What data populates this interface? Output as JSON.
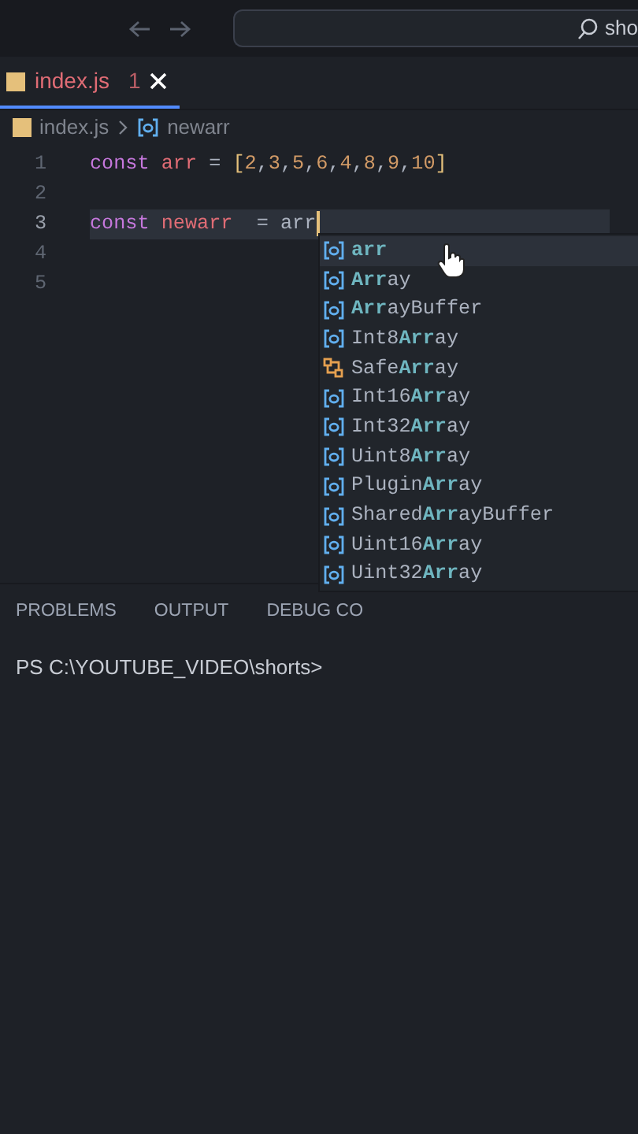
{
  "titlebar": {
    "search": {
      "value": "sho"
    }
  },
  "tabs": [
    {
      "label": "index.js",
      "problems": "1",
      "selected": true
    }
  ],
  "breadcrumb": [
    {
      "label": "index.js",
      "kind": "file"
    },
    {
      "label": "newarr",
      "kind": "variable"
    }
  ],
  "lines": [
    {
      "number": "1",
      "current": false,
      "tokens": [
        {
          "text": "const ",
          "kind": "keyword"
        },
        {
          "text": "arr",
          "kind": "variable"
        },
        {
          "text": " = ",
          "kind": "plain"
        },
        {
          "text": "[",
          "kind": "bracket"
        },
        {
          "text": "2",
          "kind": "number"
        },
        {
          "text": ",",
          "kind": "plain"
        },
        {
          "text": "3",
          "kind": "number"
        },
        {
          "text": ",",
          "kind": "plain"
        },
        {
          "text": "5",
          "kind": "number"
        },
        {
          "text": ",",
          "kind": "plain"
        },
        {
          "text": "6",
          "kind": "number"
        },
        {
          "text": ",",
          "kind": "plain"
        },
        {
          "text": "4",
          "kind": "number"
        },
        {
          "text": ",",
          "kind": "plain"
        },
        {
          "text": "8",
          "kind": "number"
        },
        {
          "text": ",",
          "kind": "plain"
        },
        {
          "text": "9",
          "kind": "number"
        },
        {
          "text": ",",
          "kind": "plain"
        },
        {
          "text": "10",
          "kind": "number"
        },
        {
          "text": "]",
          "kind": "bracket"
        }
      ]
    },
    {
      "number": "2",
      "current": false
    },
    {
      "number": "3",
      "current": true,
      "tokens": [
        {
          "text": "const ",
          "kind": "keyword"
        },
        {
          "text": "newarr",
          "kind": "variable"
        },
        {
          "text": "  = arr",
          "kind": "plain"
        }
      ]
    },
    {
      "number": "4",
      "current": false
    },
    {
      "number": "5",
      "current": false
    }
  ],
  "suggestions": [
    {
      "label": "**arr**",
      "kind": "variable",
      "selected": true
    },
    {
      "label": "**Arr**ay",
      "kind": "variable",
      "selected": false
    },
    {
      "label": "**Arr**ayBuffer",
      "kind": "variable",
      "selected": false
    },
    {
      "label": "Int8**Arr**ay",
      "kind": "variable",
      "selected": false
    },
    {
      "label": "Safe**Arr**ay",
      "kind": "class",
      "selected": false
    },
    {
      "label": "Int16**Arr**ay",
      "kind": "variable",
      "selected": false
    },
    {
      "label": "Int32**Arr**ay",
      "kind": "variable",
      "selected": false
    },
    {
      "label": "Uint8**Arr**ay",
      "kind": "variable",
      "selected": false
    },
    {
      "label": "Plugin**Arr**ay",
      "kind": "variable",
      "selected": false
    },
    {
      "label": "Shared**Arr**ayBuffer",
      "kind": "variable",
      "selected": false
    },
    {
      "label": "Uint16**Arr**ay",
      "kind": "variable",
      "selected": false
    },
    {
      "label": "Uint32**Arr**ay",
      "kind": "variable",
      "selected": false
    }
  ],
  "panel": {
    "tabs": [
      {
        "label": "PROBLEMS",
        "selected": false
      },
      {
        "label": "OUTPUT",
        "selected": false
      },
      {
        "label": "DEBUG CO",
        "selected": false
      }
    ],
    "terminal": {
      "prompt": "PS C:\\YOUTUBE_VIDEO\\shorts>"
    }
  }
}
